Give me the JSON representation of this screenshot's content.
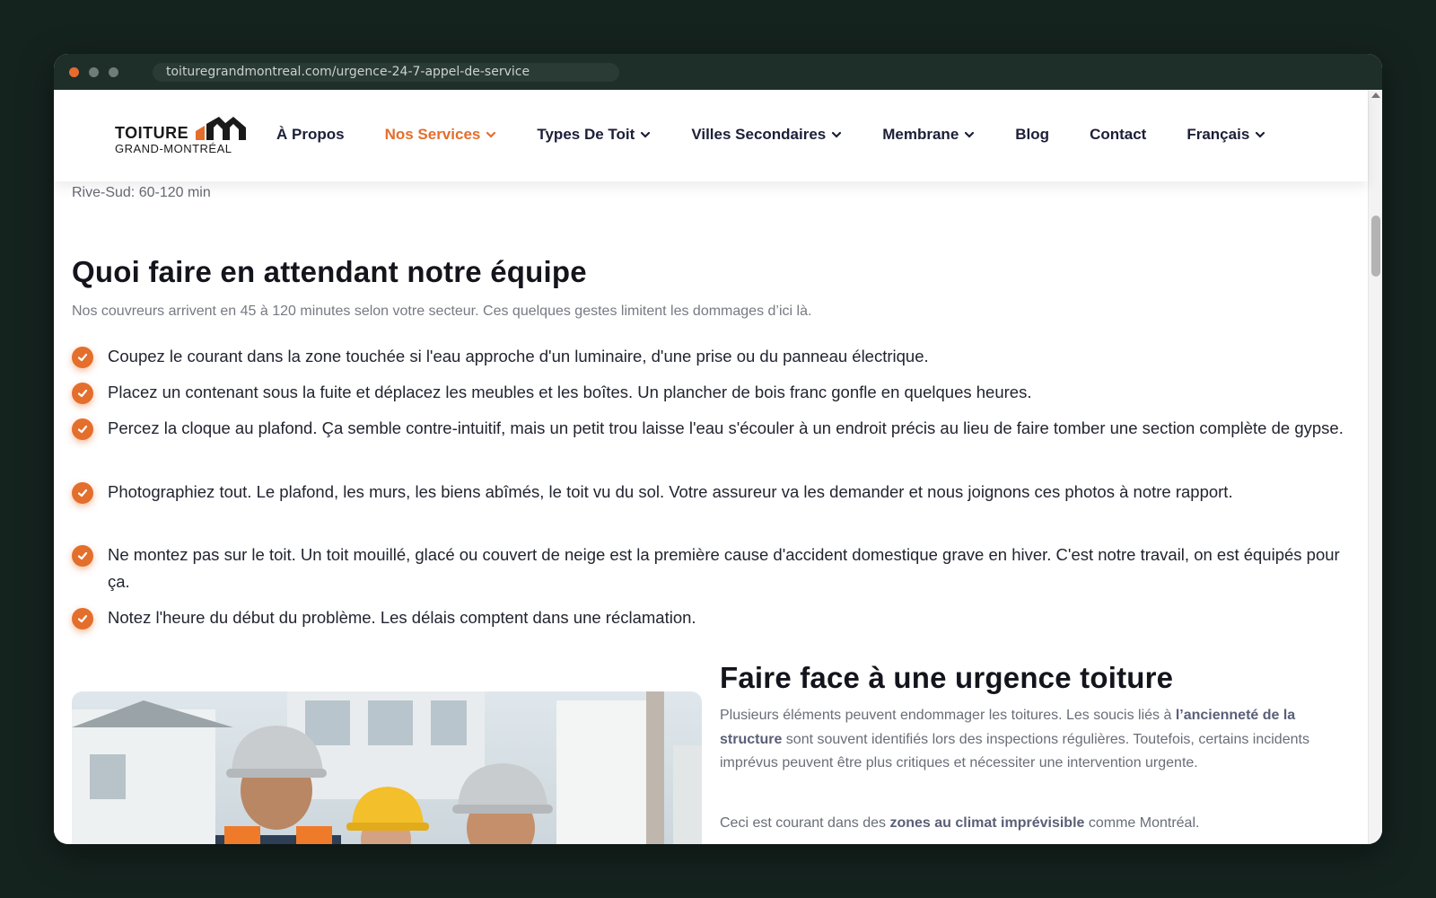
{
  "browser": {
    "url": "toituregrandmontreal.com/urgence-24-7-appel-de-service"
  },
  "logo": {
    "line1": "TOITURE",
    "line2": "GRAND-MONTRÉAL"
  },
  "nav": {
    "items": [
      {
        "label": "À Propos",
        "has_dropdown": false,
        "active": false
      },
      {
        "label": "Nos Services",
        "has_dropdown": true,
        "active": true
      },
      {
        "label": "Types De Toit",
        "has_dropdown": true,
        "active": false
      },
      {
        "label": "Villes Secondaires",
        "has_dropdown": true,
        "active": false
      },
      {
        "label": "Membrane",
        "has_dropdown": true,
        "active": false
      },
      {
        "label": "Blog",
        "has_dropdown": false,
        "active": false
      },
      {
        "label": "Contact",
        "has_dropdown": false,
        "active": false
      },
      {
        "label": "Français",
        "has_dropdown": true,
        "active": false
      }
    ]
  },
  "section_wait": {
    "prev_line": "Rive-Sud: 60-120 min",
    "title": "Quoi faire en attendant notre équipe",
    "lead": "Nos couvreurs arrivent en 45 à 120 minutes selon votre secteur. Ces quelques gestes limitent les dommages d’ici là.",
    "checklist": [
      "Coupez le courant dans la zone touchée si l'eau approche d'un luminaire, d'une prise ou du panneau électrique.",
      "Placez un contenant sous la fuite et déplacez les meubles et les boîtes. Un plancher de bois franc gonfle en quelques heures.",
      "Percez la cloque au plafond. Ça semble contre-intuitif, mais un petit trou laisse l'eau s'écouler à un endroit précis au lieu de faire tomber une section complète de gypse.",
      "Photographiez tout. Le plafond, les murs, les biens abîmés, le toit vu du sol. Votre assureur va les demander et nous joignons ces photos à notre rapport.",
      "Ne montez pas sur le toit. Un toit mouillé, glacé ou couvert de neige est la première cause d'accident domestique grave en hiver. C'est notre travail, on est équipés pour ça.",
      "Notez l'heure du début du problème. Les délais comptent dans une réclamation."
    ]
  },
  "section_urgence": {
    "title": "Faire face à une urgence toiture",
    "p1_a": "Plusieurs éléments peuvent endommager les toitures. Les soucis liés à ",
    "p1_b": "l’ancienneté de la structure",
    "p1_c": " sont souvent identifiés lors des inspections régulières. Toutefois, certains incidents imprévus peuvent être plus critiques et nécessiter une intervention urgente.",
    "p2_a": "Ceci est courant dans des ",
    "p2_b": "zones au climat imprévisible",
    "p2_c": " comme Montréal.",
    "image": "photo-workers-hardhats"
  },
  "colors": {
    "accent": "#e46e2c",
    "nav_text": "#1c1f38",
    "background": "#15231f"
  }
}
